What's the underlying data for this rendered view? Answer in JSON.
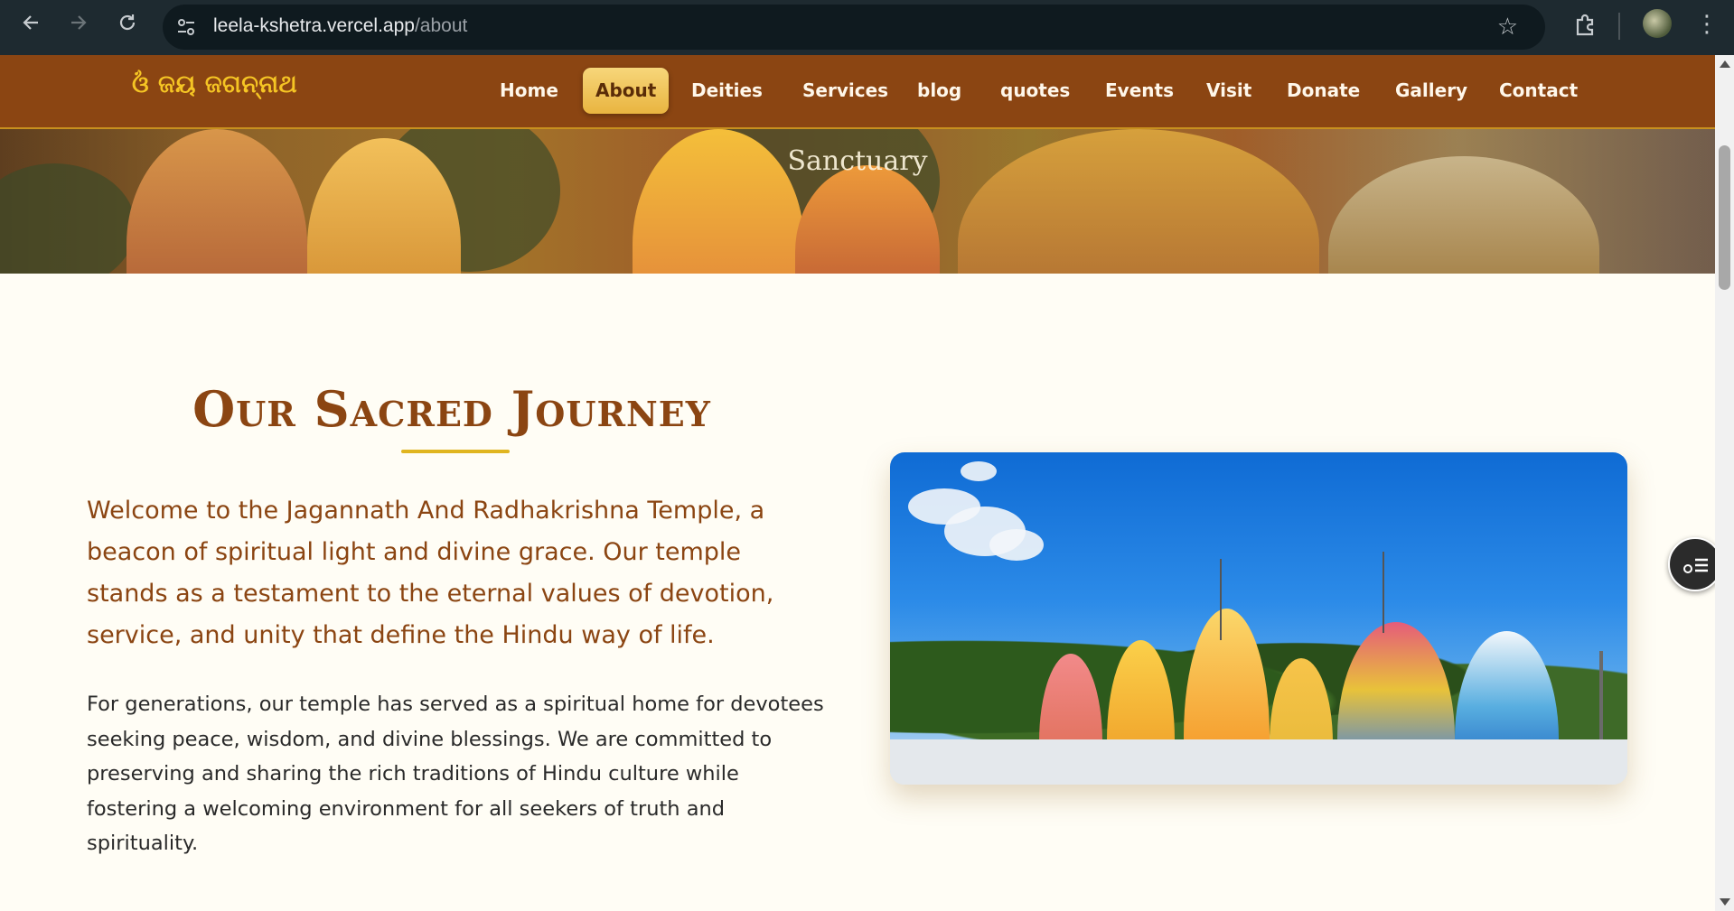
{
  "browser": {
    "url_host": "leela-kshetra.vercel.app",
    "url_path": "/about",
    "icons": [
      "back-icon",
      "forward-icon",
      "reload-icon",
      "site-settings-icon",
      "bookmark-star-icon",
      "extensions-icon",
      "profile-avatar",
      "more-menu-icon"
    ]
  },
  "site": {
    "brand": "ଓଁ ଜୟ ଜଗନ୍ନାଥ",
    "nav": [
      {
        "label": "Home"
      },
      {
        "label": "About"
      },
      {
        "label": "Deities"
      },
      {
        "label": "Services"
      },
      {
        "label": "blog"
      },
      {
        "label": "quotes"
      },
      {
        "label": "Events"
      },
      {
        "label": "Visit"
      },
      {
        "label": "Donate"
      },
      {
        "label": "Gallery"
      },
      {
        "label": "Contact"
      }
    ],
    "active_nav": "About",
    "hero_text": "Sanctuary"
  },
  "about": {
    "heading": "Our Sacred Journey",
    "lead": "Welcome to the Jagannath And Radhakrishna Temple, a beacon of spiritual light and divine grace. Our temple stands as a testament to the eternal values of devotion, service, and unity that define the Hindu way of life.",
    "body": "For generations, our temple has served as a spiritual home for devotees seeking peace, wisdom, and divine blessings. We are committed to preserving and sharing the rich traditions of Hindu culture while fostering a welcoming environment for all seekers of truth and spirituality."
  },
  "colors": {
    "nav_bg": "#8b4512",
    "brand": "#f5c524",
    "active_nav": "#e9b440",
    "heading": "#8b4512",
    "underline": "#e0b520",
    "page_bg": "#fffdf5"
  }
}
